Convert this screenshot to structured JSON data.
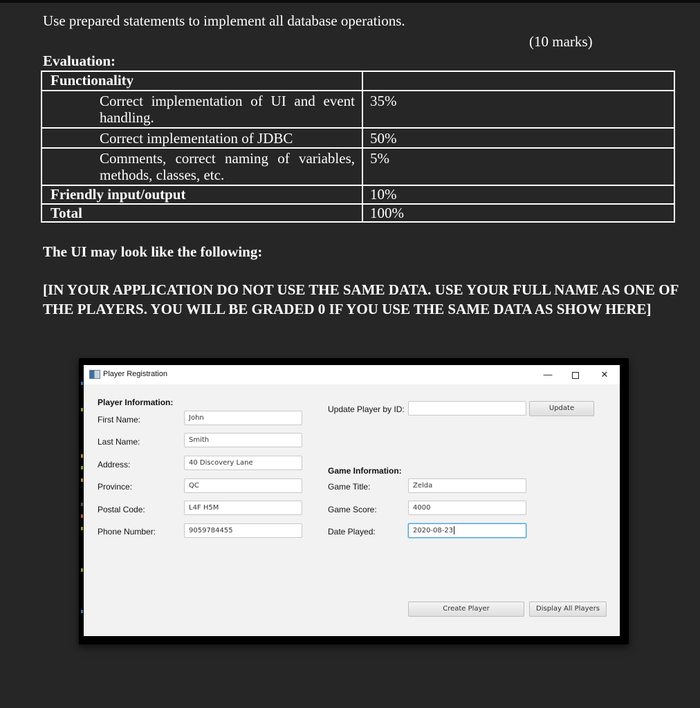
{
  "document": {
    "intro": "Use prepared statements to implement all database operations.",
    "marks": "(10 marks)",
    "evaluation_heading": "Evaluation:",
    "rubric": {
      "rows": [
        {
          "criterion": "Functionality",
          "weight": "",
          "kind": "category"
        },
        {
          "criterion": "Correct implementation of UI and event handling.",
          "weight": "35%",
          "kind": "sub"
        },
        {
          "criterion": "Correct implementation of JDBC",
          "weight": "50%",
          "kind": "sub"
        },
        {
          "criterion": "Comments, correct naming of variables, methods, classes, etc.",
          "weight": "5%",
          "kind": "sub"
        },
        {
          "criterion": "Friendly input/output",
          "weight": "10%",
          "kind": "category"
        },
        {
          "criterion": "Total",
          "weight": "100%",
          "kind": "category"
        }
      ]
    },
    "ui_heading": "The UI may look like the following:",
    "warning": "[IN YOUR APPLICATION DO NOT USE THE SAME DATA. USE YOUR FULL NAME AS ONE OF THE PLAYERS. YOU WILL BE GRADED 0 IF YOU USE THE SAME DATA AS SHOW HERE]"
  },
  "window": {
    "title": "Player Registration",
    "icons": {
      "app": "app-window-icon",
      "minimize": "minimize-icon",
      "maximize": "maximize-icon",
      "close": "close-icon"
    },
    "controls": {
      "minimize": "—",
      "close": "✕"
    },
    "player_section": {
      "heading": "Player Information:",
      "fields": [
        {
          "label": "First Name:",
          "value": "John"
        },
        {
          "label": "Last Name:",
          "value": "Smith"
        },
        {
          "label": "Address:",
          "value": "40 Discovery Lane"
        },
        {
          "label": "Province:",
          "value": "QC"
        },
        {
          "label": "Postal Code:",
          "value": "L4F H5M"
        },
        {
          "label": "Phone Number:",
          "value": "9059784455"
        }
      ]
    },
    "update": {
      "label": "Update Player by ID:",
      "value": "",
      "button": "Update"
    },
    "game_section": {
      "heading": "Game Information:",
      "fields": [
        {
          "label": "Game Title:",
          "value": "Zelda"
        },
        {
          "label": "Game Score:",
          "value": "4000"
        },
        {
          "label": "Date Played:",
          "value": "2020-08-23"
        }
      ]
    },
    "buttons": {
      "create": "Create Player",
      "display_all": "Display All Players"
    }
  }
}
